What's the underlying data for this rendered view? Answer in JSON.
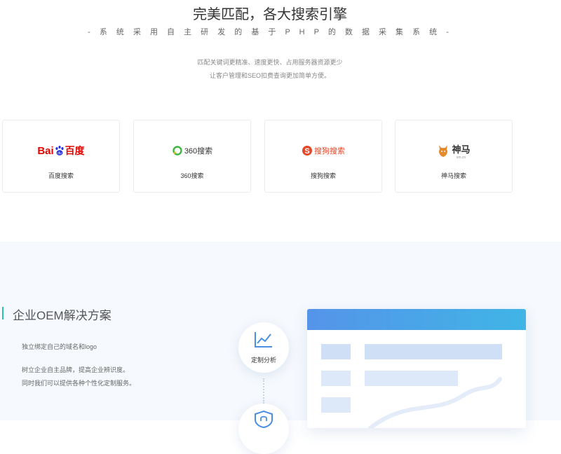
{
  "hero": {
    "title": "完美匹配，各大搜索引擎",
    "subtitle": "- 系 统 采 用 自 主 研 发 的 基 于 P H P 的 数 据 采 集 系 统 -",
    "desc_line1": "匹配关键词更精准、速度更快、占用服务器资源更少",
    "desc_line2": "让客户管理和SEO扣费查询更加简单方便。"
  },
  "engines": [
    {
      "name": "百度搜索",
      "logo_text_a": "Bai",
      "logo_text_b": "百度"
    },
    {
      "name": "360搜索",
      "logo_text": "360搜索"
    },
    {
      "name": "搜狗搜索",
      "logo_text": "搜狗搜索"
    },
    {
      "name": "神马搜索",
      "logo_text": "神马",
      "logo_sub": "sm.cn"
    }
  ],
  "oem": {
    "title": "企业OEM解决方案",
    "line1": "独立绑定自己的域名和logo",
    "line2": "树立企业自主品牌，提高企业辨识度。",
    "line3": "同时我们可以提供各种个性化定制服务。",
    "feature1_label": "定制分析"
  },
  "colors": {
    "accent_bar": "#2bc3b4",
    "baidu_red": "#e10602",
    "baidu_blue": "#2932e1",
    "qihoo_green": "#3fb63f",
    "sogou_red": "#e4482a",
    "shenma_orange": "#e58a2d",
    "panel_gradient_start": "#5594e9",
    "panel_gradient_end": "#40b5e6"
  },
  "icons": [
    "baidu-logo",
    "360-logo",
    "sogou-logo",
    "shenma-logo",
    "chart-line-icon",
    "shield-icon"
  ]
}
